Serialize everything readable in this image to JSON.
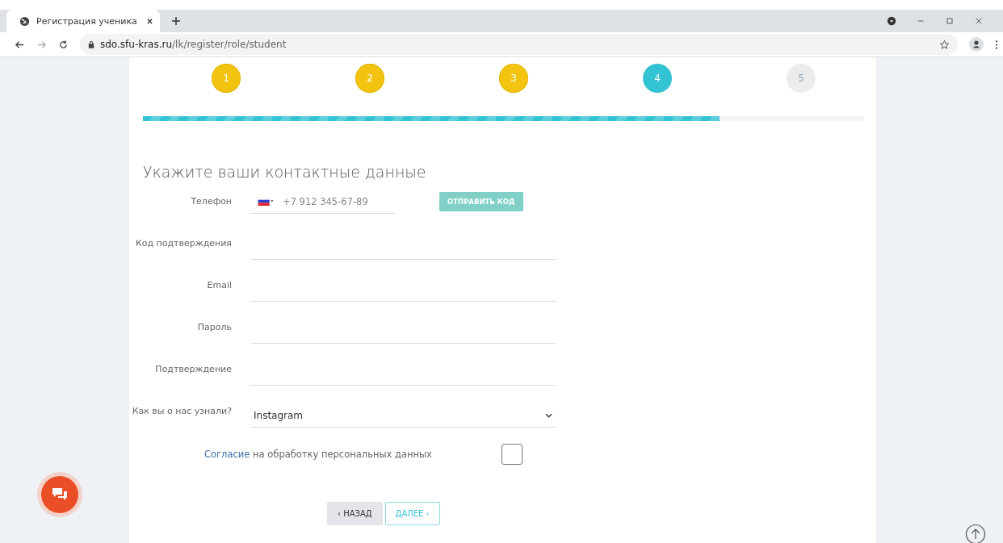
{
  "browser": {
    "tab_title": "Регистрация ученика",
    "url_host": "sdo.sfu-kras.ru",
    "url_path": "/lk/register/role/student"
  },
  "steps": [
    {
      "label": "1",
      "done": true,
      "selected": false
    },
    {
      "label": "2",
      "done": true,
      "selected": false
    },
    {
      "label": "3",
      "done": true,
      "selected": false
    },
    {
      "label": "4",
      "done": false,
      "selected": true
    },
    {
      "label": "5",
      "done": false,
      "selected": false
    }
  ],
  "progress": {
    "level": 0.8
  },
  "heading": "Укажите ваши контактные данные",
  "fields": [
    {
      "kind": "phone",
      "label": "Телефон",
      "placeholder": "+7 912 345-67-89",
      "button": "ОТПРАВИТЬ КОД"
    },
    {
      "kind": "text",
      "label": "Код подтверждения"
    },
    {
      "kind": "text",
      "label": "Email"
    },
    {
      "kind": "text",
      "label": "Пароль"
    },
    {
      "kind": "text",
      "label": "Подтверждение"
    },
    {
      "kind": "select",
      "label": "Как вы о нас узнали?",
      "value": "Instagram"
    }
  ],
  "consent": {
    "link": "Согласие",
    "text": "на обработку персональных данных",
    "checked": false
  },
  "buttons": {
    "back": "‹ НАЗАД",
    "next": "ДАЛЕЕ ›"
  }
}
